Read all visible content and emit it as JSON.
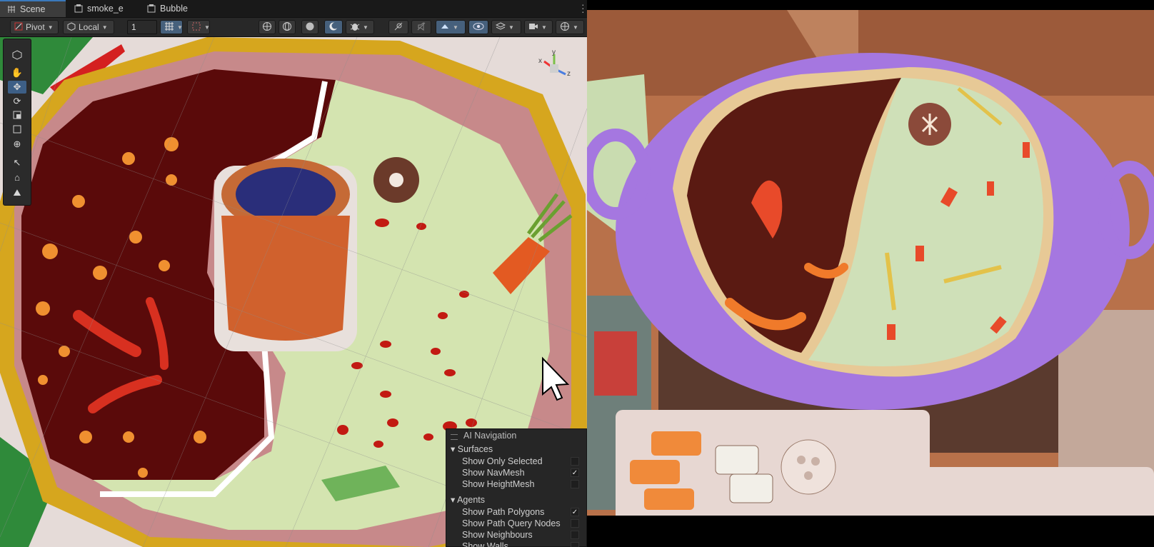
{
  "tabs": [
    {
      "label": "Scene",
      "icon": "grid-icon",
      "active": true
    },
    {
      "label": "smoke_e",
      "icon": "prefab-icon",
      "active": false
    },
    {
      "label": "Bubble",
      "icon": "prefab-icon",
      "active": false
    }
  ],
  "toolbar": {
    "pivot_label": "Pivot",
    "space_label": "Local",
    "snap_value": "1"
  },
  "ai_navigation": {
    "title": "AI Navigation",
    "surfaces": {
      "header": "Surfaces",
      "items": [
        {
          "label": "Show Only Selected",
          "checked": false
        },
        {
          "label": "Show NavMesh",
          "checked": true
        },
        {
          "label": "Show HeightMesh",
          "checked": false
        }
      ]
    },
    "agents": {
      "header": "Agents",
      "items": [
        {
          "label": "Show Path Polygons",
          "checked": true
        },
        {
          "label": "Show Path Query Nodes",
          "checked": false
        },
        {
          "label": "Show Neighbours",
          "checked": false
        },
        {
          "label": "Show Walls",
          "checked": false
        }
      ]
    }
  },
  "gizmo": {
    "x": "x",
    "y": "y",
    "z": "z"
  },
  "colors": {
    "accent": "#3a79bb",
    "spicy_broth": "#5a0a0a",
    "clear_broth": "#d4e4b0",
    "pot_rim_scene": "#c7898a",
    "pot_game": "#9b7de0"
  }
}
